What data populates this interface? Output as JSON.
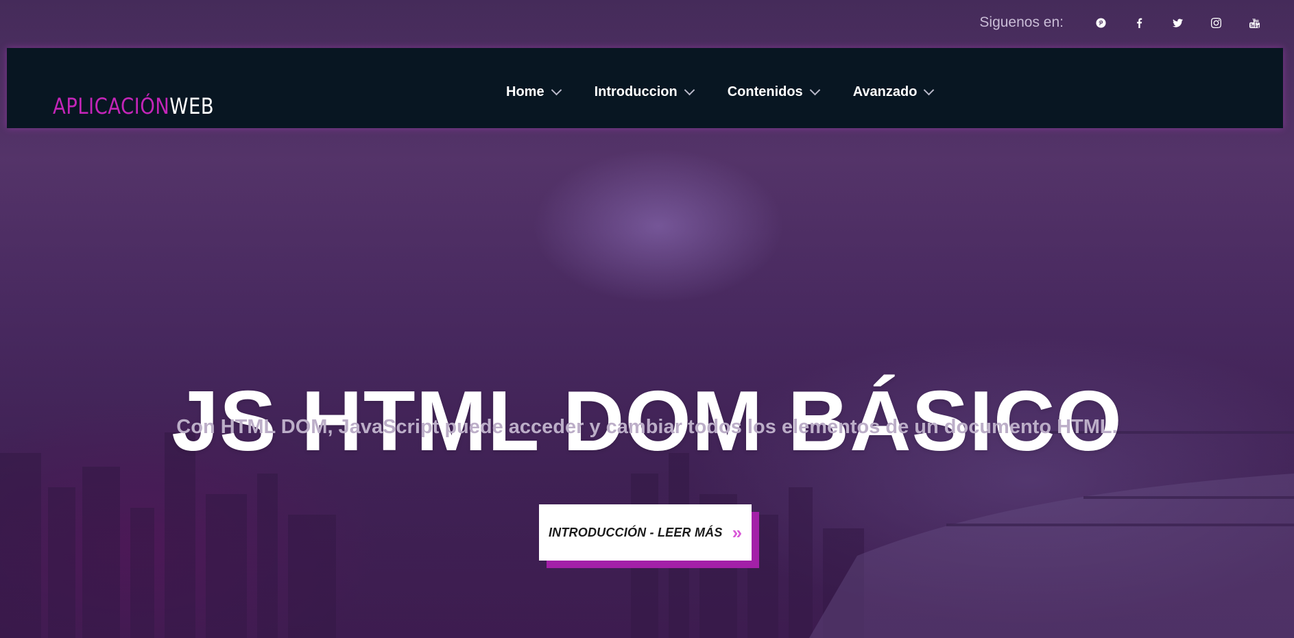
{
  "topbar": {
    "follow_label": "Siguenos en:",
    "social_icons": [
      "pinterest-icon",
      "facebook-icon",
      "twitter-icon",
      "instagram-icon",
      "youtube-icon"
    ]
  },
  "navbar": {
    "brand_part1": "APLICACIÓN",
    "brand_part2": "WEB",
    "menu": [
      {
        "label": "Home"
      },
      {
        "label": "Introduccion"
      },
      {
        "label": "Contenidos"
      },
      {
        "label": "Avanzado"
      }
    ]
  },
  "hero": {
    "title": "JS HTML DOM BÁSICO",
    "subtitle": "Con HTML DOM, JavaScript puede acceder y cambiar todos los elementos de un documento HTML.",
    "cta_label": "INTRODUCCIÓN - LEER MÁS",
    "cta_icon": "double-chevron-right-icon"
  },
  "colors": {
    "navbar_bg": "#081622",
    "brand_accent": "#c325b8",
    "cta_shadow": "#a320a8",
    "cta_bg": "#ffffff"
  }
}
